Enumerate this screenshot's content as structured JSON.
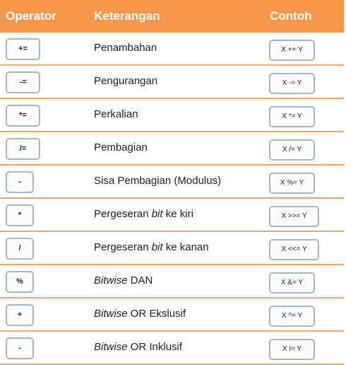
{
  "header": {
    "operator": "Operator",
    "keterangan": "Keterangan",
    "contoh": "Contoh"
  },
  "colors": {
    "header_bg": "#f7954a",
    "row_border": "#f7a15e",
    "box_border": "#aab4c0"
  },
  "rows": [
    {
      "operator": "+=",
      "desc_pre": "Penambahan",
      "desc_em": "",
      "desc_post": "",
      "example": "X += Y"
    },
    {
      "operator": "-=",
      "desc_pre": "Pengurangan",
      "desc_em": "",
      "desc_post": "",
      "example": "X -= Y"
    },
    {
      "operator": "*=",
      "desc_pre": "Perkalian",
      "desc_em": "",
      "desc_post": "",
      "example": "X *= Y"
    },
    {
      "operator": "/=",
      "desc_pre": "Pembagian",
      "desc_em": "",
      "desc_post": "",
      "example": "X /= Y"
    },
    {
      "operator": "-",
      "desc_pre": "Sisa Pembagian (Modulus)",
      "desc_em": "",
      "desc_post": "",
      "example": "X %= Y"
    },
    {
      "operator": "*",
      "desc_pre": "Pergeseran ",
      "desc_em": "bit",
      "desc_post": " ke kiri",
      "example": "X >>= Y"
    },
    {
      "operator": "/",
      "desc_pre": "Pergeseran ",
      "desc_em": "bit",
      "desc_post": " ke kanan",
      "example": "X <<= Y"
    },
    {
      "operator": "%",
      "desc_pre": "",
      "desc_em": "Bitwise",
      "desc_post": " DAN",
      "example": "X &= Y"
    },
    {
      "operator": "+",
      "desc_pre": "",
      "desc_em": "Bitwise",
      "desc_post": " OR Ekslusif",
      "example": "X ^= Y"
    },
    {
      "operator": "-",
      "desc_pre": "",
      "desc_em": "Bitwise",
      "desc_post": " OR Inklusif",
      "example": "X I= Y"
    }
  ]
}
